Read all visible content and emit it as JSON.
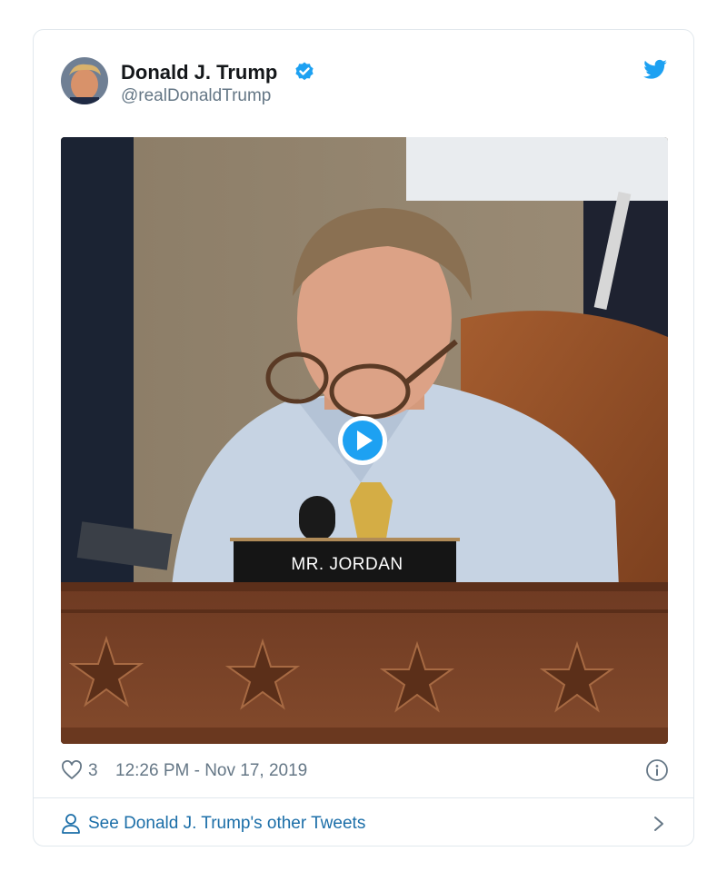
{
  "tweet": {
    "author_name": "Donald J. Trump",
    "author_handle": "@realDonaldTrump",
    "like_count": "3",
    "timestamp": "12:26 PM - Nov 17, 2019",
    "see_more_label": "See Donald J. Trump's other Tweets"
  },
  "media": {
    "nameplate_text": "MR. JORDAN",
    "play_icon": "play-icon"
  },
  "icons": {
    "verified": "verified-badge-icon",
    "brand": "twitter-bird-icon",
    "like": "heart-icon",
    "info": "info-icon",
    "profile": "person-icon",
    "next": "chevron-right-icon"
  },
  "colors": {
    "brand_blue": "#1da1f2",
    "link_blue": "#1b6ea8",
    "text_primary": "#14171a",
    "text_secondary": "#657786",
    "border": "#e1e8ed"
  }
}
